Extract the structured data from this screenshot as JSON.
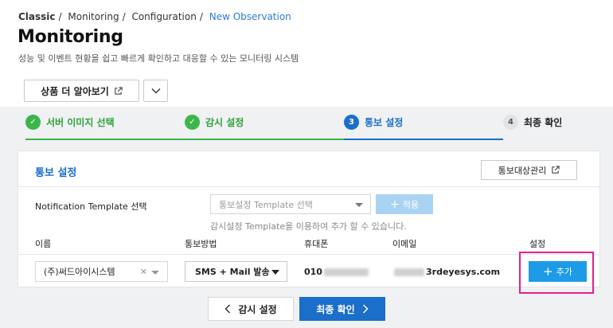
{
  "breadcrumb": [
    "Classic",
    "Monitoring",
    "Configuration",
    "New Observation"
  ],
  "page": {
    "title": "Monitoring",
    "subtitle": "성능 및 이벤트 현황을 쉽고 빠르게 확인하고 대응할 수 있는 모니터링 시스템",
    "more_label": "상품 더 알아보기"
  },
  "steps": [
    {
      "index": "✓",
      "label": "서버 이미지 선택",
      "state": "done"
    },
    {
      "index": "✓",
      "label": "감시 설정",
      "state": "done"
    },
    {
      "index": "3",
      "label": "통보 설정",
      "state": "active"
    },
    {
      "index": "4",
      "label": "최종 확인",
      "state": "todo"
    }
  ],
  "card": {
    "title": "통보 설정",
    "target_button": "통보대상관리"
  },
  "template": {
    "label": "Notification Template 선택",
    "placeholder": "통보설정 Template 선택",
    "apply_label": "적용",
    "hint": "감시설정 Template을 이용하여 추가 할 수 있습니다."
  },
  "table": {
    "headers": {
      "name": "이름",
      "method": "통보방법",
      "phone": "휴대폰",
      "email": "이메일",
      "settings": "설정"
    },
    "row": {
      "name": "(주)써드아이시스템",
      "method": "SMS + Mail 발송",
      "phone_prefix": "010",
      "email_suffix": "3rdeyesys.com",
      "add_label": "추가"
    }
  },
  "footer": {
    "prev_label": "감시 설정",
    "next_label": "최종 확인"
  },
  "colors": {
    "accent": "#1b6ec9",
    "success": "#3cb64a",
    "add_button": "#1d9be6",
    "highlight": "#e0208f"
  }
}
